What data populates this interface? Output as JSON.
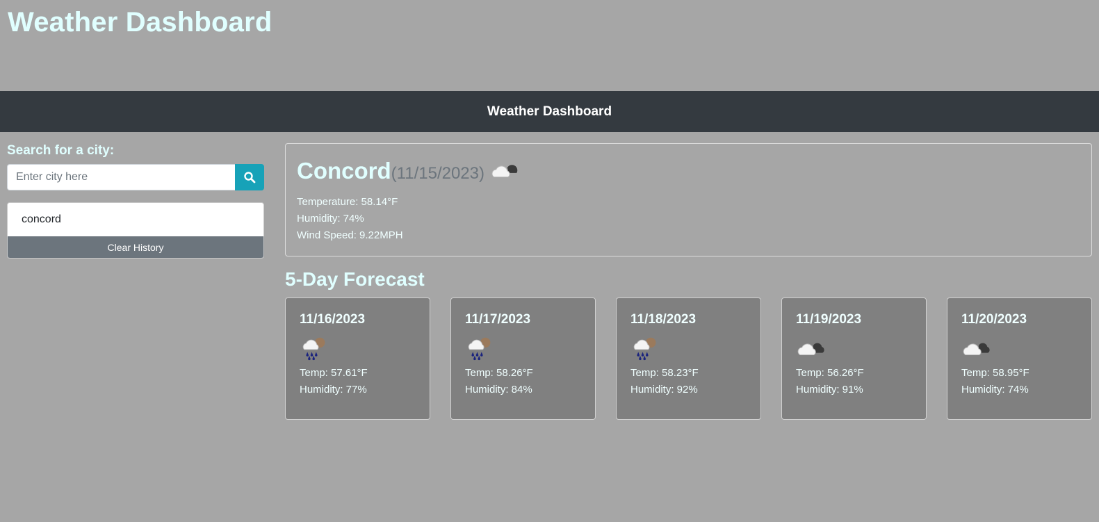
{
  "page": {
    "heading": "Weather Dashboard"
  },
  "navbar": {
    "title": "Weather Dashboard"
  },
  "search": {
    "label": "Search for a city:",
    "placeholder": "Enter city here",
    "value": "",
    "button_icon": "search-icon"
  },
  "history": {
    "items": [
      "concord"
    ],
    "clear_label": "Clear History"
  },
  "current": {
    "city": "Concord",
    "date": "(11/15/2023)",
    "icon": "cloudy-night-icon",
    "temperature": "Temperature: 58.14°F",
    "humidity": "Humidity: 74%",
    "wind": "Wind Speed: 9.22MPH"
  },
  "forecast": {
    "heading": "5-Day Forecast",
    "days": [
      {
        "date": "11/16/2023",
        "icon": "rain-icon",
        "temp": "Temp: 57.61°F",
        "humidity": "Humidity: 77%"
      },
      {
        "date": "11/17/2023",
        "icon": "rain-icon",
        "temp": "Temp: 58.26°F",
        "humidity": "Humidity: 84%"
      },
      {
        "date": "11/18/2023",
        "icon": "rain-icon",
        "temp": "Temp: 58.23°F",
        "humidity": "Humidity: 92%"
      },
      {
        "date": "11/19/2023",
        "icon": "cloudy-icon",
        "temp": "Temp: 56.26°F",
        "humidity": "Humidity: 91%"
      },
      {
        "date": "11/20/2023",
        "icon": "cloudy-icon",
        "temp": "Temp: 58.95°F",
        "humidity": "Humidity: 74%"
      }
    ]
  },
  "colors": {
    "background": "#a6a6a6",
    "navbar": "#343a40",
    "accent_text": "#e0ffff",
    "search_button": "#17a2b8",
    "clear_button": "#6c757d",
    "forecast_card": "#808080"
  }
}
